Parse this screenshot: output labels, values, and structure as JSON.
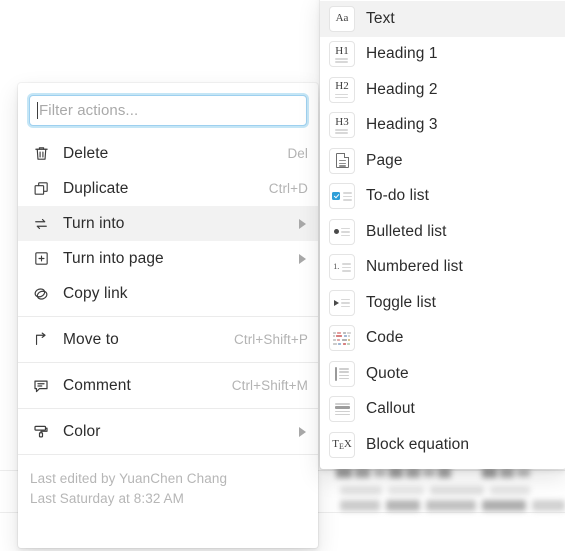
{
  "action_menu": {
    "filter": {
      "placeholder": "Filter actions...",
      "value": ""
    },
    "groups": [
      {
        "items": [
          {
            "label": "Delete",
            "shortcut": "Del",
            "icon": "trash-icon",
            "submenu": false,
            "active": false
          },
          {
            "label": "Duplicate",
            "shortcut": "Ctrl+D",
            "icon": "duplicate-icon",
            "submenu": false,
            "active": false
          },
          {
            "label": "Turn into",
            "shortcut": "",
            "icon": "turn-into-icon",
            "submenu": true,
            "active": true
          },
          {
            "label": "Turn into page",
            "shortcut": "",
            "icon": "turn-into-page-icon",
            "submenu": true,
            "active": false
          },
          {
            "label": "Copy link",
            "shortcut": "",
            "icon": "link-icon",
            "submenu": false,
            "active": false
          }
        ]
      },
      {
        "items": [
          {
            "label": "Move to",
            "shortcut": "Ctrl+Shift+P",
            "icon": "move-to-icon",
            "submenu": false,
            "active": false
          }
        ]
      },
      {
        "items": [
          {
            "label": "Comment",
            "shortcut": "Ctrl+Shift+M",
            "icon": "comment-icon",
            "submenu": false,
            "active": false
          }
        ]
      },
      {
        "items": [
          {
            "label": "Color",
            "shortcut": "",
            "icon": "paint-roller-icon",
            "submenu": true,
            "active": false
          }
        ]
      }
    ],
    "footer": {
      "edited_by": "Last edited by YuanChen Chang",
      "edited_at": "Last Saturday at 8:32 AM"
    }
  },
  "turn_into_submenu": {
    "items": [
      {
        "label": "Text",
        "icon": "text-tile-icon",
        "active": true
      },
      {
        "label": "Heading 1",
        "icon": "heading-1-tile-icon",
        "active": false
      },
      {
        "label": "Heading 2",
        "icon": "heading-2-tile-icon",
        "active": false
      },
      {
        "label": "Heading 3",
        "icon": "heading-3-tile-icon",
        "active": false
      },
      {
        "label": "Page",
        "icon": "page-tile-icon",
        "active": false
      },
      {
        "label": "To-do list",
        "icon": "todo-list-tile-icon",
        "active": false
      },
      {
        "label": "Bulleted list",
        "icon": "bulleted-list-tile-icon",
        "active": false
      },
      {
        "label": "Numbered list",
        "icon": "numbered-list-tile-icon",
        "active": false
      },
      {
        "label": "Toggle list",
        "icon": "toggle-list-tile-icon",
        "active": false
      },
      {
        "label": "Code",
        "icon": "code-tile-icon",
        "active": false
      },
      {
        "label": "Quote",
        "icon": "quote-tile-icon",
        "active": false
      },
      {
        "label": "Callout",
        "icon": "callout-tile-icon",
        "active": false
      },
      {
        "label": "Block equation",
        "icon": "block-equation-tile-icon",
        "active": false
      }
    ],
    "tile_glyphs": {
      "text": "Aa",
      "heading_1": "H1",
      "heading_2": "H2",
      "heading_3": "H3",
      "numbered": "1.",
      "equation": "TEX"
    }
  },
  "colors": {
    "accent_focus_ring": "#7ec7ea",
    "accent_focus_border": "#9ed0ef",
    "hover_row": "#f2f2f2",
    "text_primary": "#2c2c2c",
    "text_muted": "#b3b3b3",
    "divider": "#ebebeb",
    "checkbox_blue": "#2f9fd8"
  }
}
